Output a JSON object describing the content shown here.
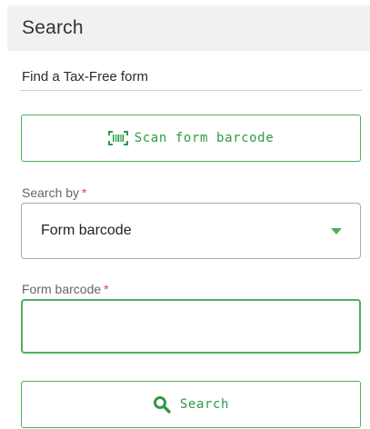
{
  "header": {
    "title": "Search"
  },
  "section": {
    "heading": "Find a Tax-Free form"
  },
  "scan_button": {
    "icon": "barcode-scan-icon",
    "label": "Scan form barcode"
  },
  "search_by": {
    "label": "Search by",
    "required_mark": "*",
    "selected": "Form barcode",
    "icon": "caret-down-icon"
  },
  "form_barcode": {
    "label": "Form barcode",
    "required_mark": "*",
    "value": ""
  },
  "search_button": {
    "icon": "search-icon",
    "label": "Search"
  },
  "colors": {
    "accent": "#4cb05a",
    "accent_text": "#2e9a45",
    "required": "#e53935",
    "header_bg": "#f1f1f1"
  }
}
